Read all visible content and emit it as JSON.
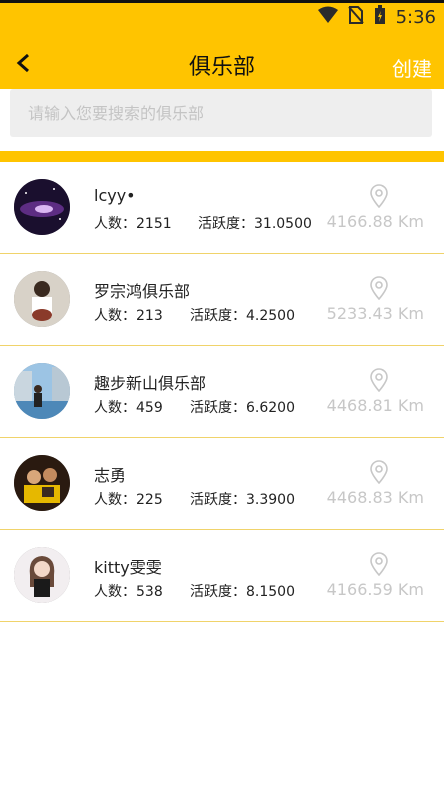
{
  "status_bar": {
    "time": "5:36"
  },
  "app_bar": {
    "title": "俱乐部",
    "create_label": "创建"
  },
  "search": {
    "placeholder": "请输入您要搜索的俱乐部"
  },
  "clubs": [
    {
      "name": "lcyy•",
      "people_label": "人数：2151",
      "activity_label": "活跃度：31.0500",
      "distance": "4166.88 Km"
    },
    {
      "name": "罗宗鸿俱乐部",
      "people_label": "人数：213",
      "activity_label": "活跃度：4.2500",
      "distance": "5233.43 Km"
    },
    {
      "name": "趣步新山俱乐部",
      "people_label": "人数：459",
      "activity_label": "活跃度：6.6200",
      "distance": "4468.81 Km"
    },
    {
      "name": "志勇",
      "people_label": "人数：225",
      "activity_label": "活跃度：3.3900",
      "distance": "4468.83 Km"
    },
    {
      "name": "kitty雯雯",
      "people_label": "人数：538",
      "activity_label": "活跃度：8.1500",
      "distance": "4166.59 Km"
    }
  ]
}
